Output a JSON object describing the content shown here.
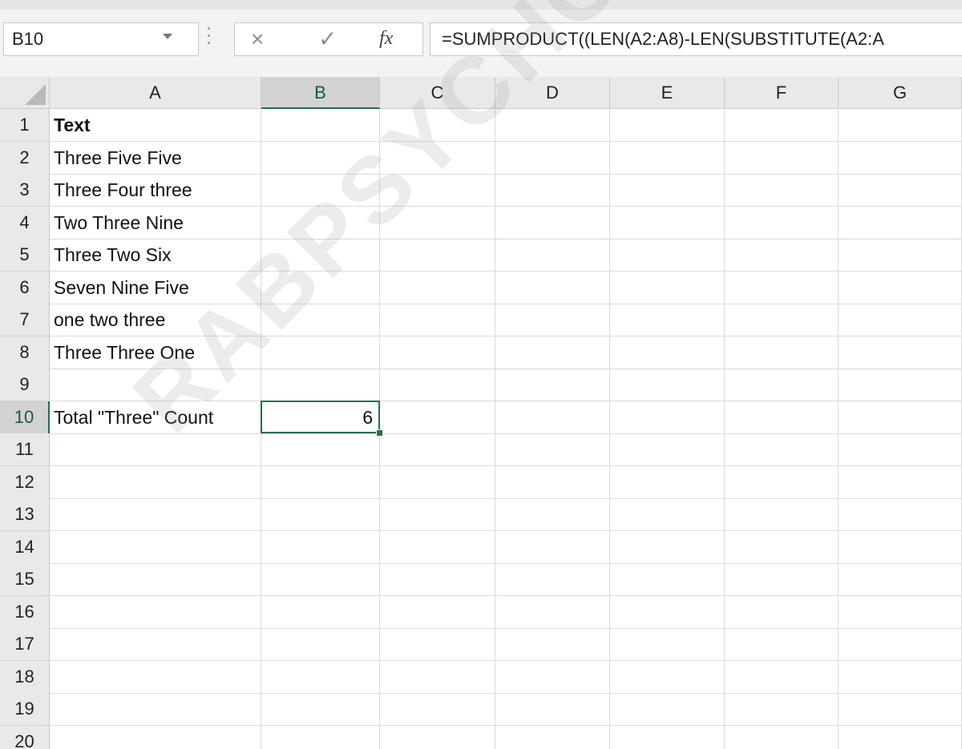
{
  "formula_bar": {
    "name_box": "B10",
    "formula": "=SUMPRODUCT((LEN(A2:A8)-LEN(SUBSTITUTE(A2:A",
    "cancel_icon": "close-icon",
    "enter_icon": "check-icon",
    "fx_label": "fx"
  },
  "sheet": {
    "columns": [
      "A",
      "B",
      "C",
      "D",
      "E",
      "F",
      "G"
    ],
    "selected_column": "B",
    "selected_row": "10",
    "rows": [
      {
        "n": "1",
        "a": "Text",
        "b": ""
      },
      {
        "n": "2",
        "a": "Three Five Five",
        "b": ""
      },
      {
        "n": "3",
        "a": "Three Four three",
        "b": ""
      },
      {
        "n": "4",
        "a": "Two Three Nine",
        "b": ""
      },
      {
        "n": "5",
        "a": "Three Two Six",
        "b": ""
      },
      {
        "n": "6",
        "a": "Seven Nine Five",
        "b": ""
      },
      {
        "n": "7",
        "a": "one two three",
        "b": ""
      },
      {
        "n": "8",
        "a": "Three Three One",
        "b": ""
      },
      {
        "n": "9",
        "a": "",
        "b": ""
      },
      {
        "n": "10",
        "a": "Total \"Three\" Count",
        "b": "6"
      },
      {
        "n": "11",
        "a": "",
        "b": ""
      },
      {
        "n": "12",
        "a": "",
        "b": ""
      },
      {
        "n": "13",
        "a": "",
        "b": ""
      },
      {
        "n": "14",
        "a": "",
        "b": ""
      },
      {
        "n": "15",
        "a": "",
        "b": ""
      },
      {
        "n": "16",
        "a": "",
        "b": ""
      },
      {
        "n": "17",
        "a": "",
        "b": ""
      },
      {
        "n": "18",
        "a": "",
        "b": ""
      },
      {
        "n": "19",
        "a": "",
        "b": ""
      },
      {
        "n": "20",
        "a": "",
        "b": ""
      }
    ]
  },
  "watermark": "RABPSYCHOLOGY.COM",
  "colors": {
    "accent": "#217346",
    "header_bg": "#e9e9e9",
    "selected_header": "#d3d3d3"
  }
}
